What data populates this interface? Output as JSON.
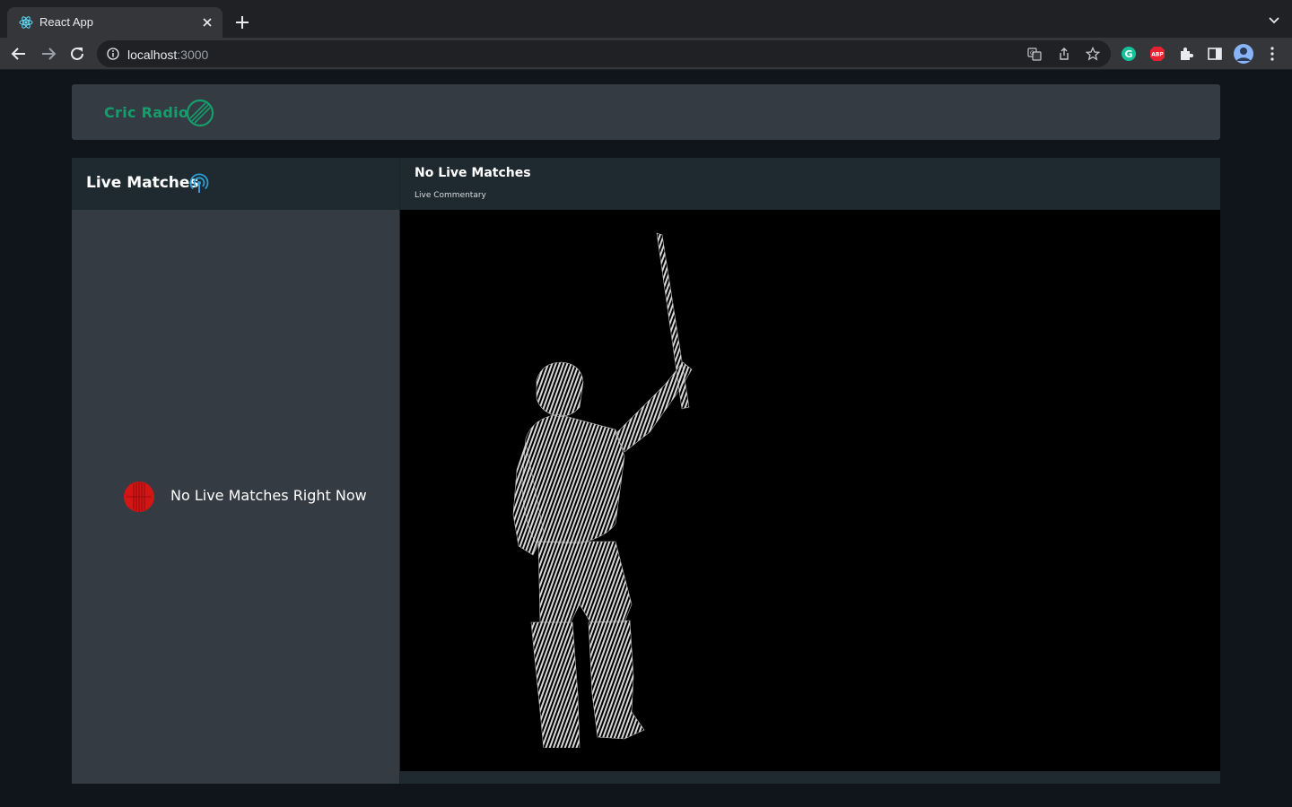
{
  "browser": {
    "tab_title": "React App",
    "url_host": "localhost",
    "url_port": ":3000",
    "icons": [
      "react-icon",
      "close-icon",
      "plus-icon",
      "chevron-down-icon",
      "back-icon",
      "forward-icon",
      "reload-icon",
      "info-icon",
      "translate-icon",
      "share-icon",
      "star-icon",
      "grammarly-icon",
      "adblock-icon",
      "puzzle-icon",
      "sidepanel-icon",
      "avatar",
      "menu-icon"
    ],
    "extensions": {
      "adblock_label": "ABP",
      "grammarly_label": "G"
    }
  },
  "header": {
    "logo_text": "Cric Radio"
  },
  "sidebar": {
    "title": "Live Matches",
    "empty_message": "No Live Matches Right Now"
  },
  "main": {
    "title": "No Live Matches",
    "subtitle": "Live Commentary"
  },
  "colors": {
    "page_bg": "#0f151b",
    "panel_bg": "#343b43",
    "panel_head_bg": "#1f2a30",
    "logo_green": "#159d6b",
    "broadcast_blue": "#2b9fd6",
    "ball_red": "#d41515"
  }
}
